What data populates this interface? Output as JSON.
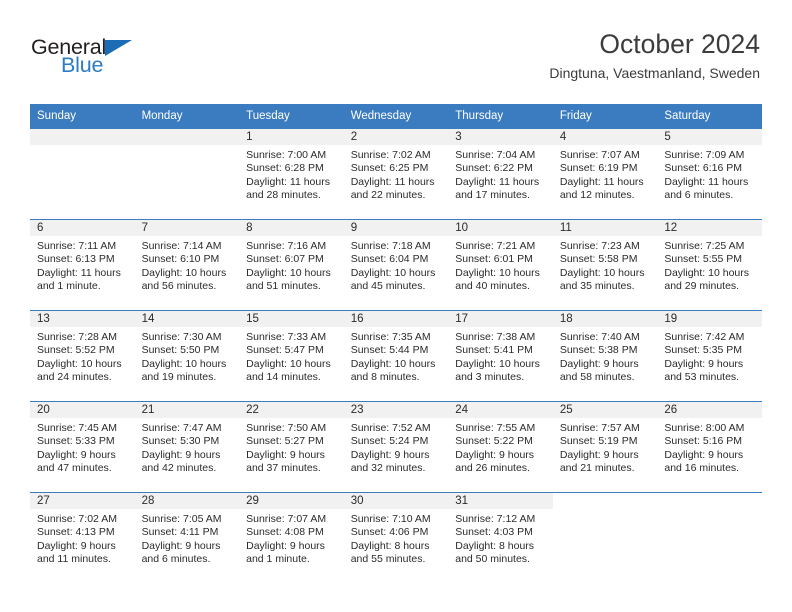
{
  "brand": {
    "name_top": "General",
    "name_bottom": "Blue",
    "triangle_color": "#1b6cb5",
    "text_color": "#231f20",
    "blue_color": "#2b7cc4"
  },
  "header": {
    "title": "October 2024",
    "subtitle": "Dingtuna, Vaestmanland, Sweden"
  },
  "theme": {
    "header_blue": "#3b7cc0",
    "day_band_gray": "#f1f1f1",
    "text": "#2b2b2b"
  },
  "weekday_headers": [
    "Sunday",
    "Monday",
    "Tuesday",
    "Wednesday",
    "Thursday",
    "Friday",
    "Saturday"
  ],
  "labels": {
    "sunrise": "Sunrise:",
    "sunset": "Sunset:",
    "daylight": "Daylight:"
  },
  "weeks": [
    [
      {
        "day": "",
        "blank": true,
        "sunrise": "",
        "sunset": "",
        "daylight_line1": "",
        "daylight_line2": ""
      },
      {
        "day": "",
        "blank": true,
        "sunrise": "",
        "sunset": "",
        "daylight_line1": "",
        "daylight_line2": ""
      },
      {
        "day": "1",
        "sunrise": "Sunrise: 7:00 AM",
        "sunset": "Sunset: 6:28 PM",
        "daylight_line1": "Daylight: 11 hours",
        "daylight_line2": "and 28 minutes."
      },
      {
        "day": "2",
        "sunrise": "Sunrise: 7:02 AM",
        "sunset": "Sunset: 6:25 PM",
        "daylight_line1": "Daylight: 11 hours",
        "daylight_line2": "and 22 minutes."
      },
      {
        "day": "3",
        "sunrise": "Sunrise: 7:04 AM",
        "sunset": "Sunset: 6:22 PM",
        "daylight_line1": "Daylight: 11 hours",
        "daylight_line2": "and 17 minutes."
      },
      {
        "day": "4",
        "sunrise": "Sunrise: 7:07 AM",
        "sunset": "Sunset: 6:19 PM",
        "daylight_line1": "Daylight: 11 hours",
        "daylight_line2": "and 12 minutes."
      },
      {
        "day": "5",
        "sunrise": "Sunrise: 7:09 AM",
        "sunset": "Sunset: 6:16 PM",
        "daylight_line1": "Daylight: 11 hours",
        "daylight_line2": "and 6 minutes."
      }
    ],
    [
      {
        "day": "6",
        "sunrise": "Sunrise: 7:11 AM",
        "sunset": "Sunset: 6:13 PM",
        "daylight_line1": "Daylight: 11 hours",
        "daylight_line2": "and 1 minute."
      },
      {
        "day": "7",
        "sunrise": "Sunrise: 7:14 AM",
        "sunset": "Sunset: 6:10 PM",
        "daylight_line1": "Daylight: 10 hours",
        "daylight_line2": "and 56 minutes."
      },
      {
        "day": "8",
        "sunrise": "Sunrise: 7:16 AM",
        "sunset": "Sunset: 6:07 PM",
        "daylight_line1": "Daylight: 10 hours",
        "daylight_line2": "and 51 minutes."
      },
      {
        "day": "9",
        "sunrise": "Sunrise: 7:18 AM",
        "sunset": "Sunset: 6:04 PM",
        "daylight_line1": "Daylight: 10 hours",
        "daylight_line2": "and 45 minutes."
      },
      {
        "day": "10",
        "sunrise": "Sunrise: 7:21 AM",
        "sunset": "Sunset: 6:01 PM",
        "daylight_line1": "Daylight: 10 hours",
        "daylight_line2": "and 40 minutes."
      },
      {
        "day": "11",
        "sunrise": "Sunrise: 7:23 AM",
        "sunset": "Sunset: 5:58 PM",
        "daylight_line1": "Daylight: 10 hours",
        "daylight_line2": "and 35 minutes."
      },
      {
        "day": "12",
        "sunrise": "Sunrise: 7:25 AM",
        "sunset": "Sunset: 5:55 PM",
        "daylight_line1": "Daylight: 10 hours",
        "daylight_line2": "and 29 minutes."
      }
    ],
    [
      {
        "day": "13",
        "sunrise": "Sunrise: 7:28 AM",
        "sunset": "Sunset: 5:52 PM",
        "daylight_line1": "Daylight: 10 hours",
        "daylight_line2": "and 24 minutes."
      },
      {
        "day": "14",
        "sunrise": "Sunrise: 7:30 AM",
        "sunset": "Sunset: 5:50 PM",
        "daylight_line1": "Daylight: 10 hours",
        "daylight_line2": "and 19 minutes."
      },
      {
        "day": "15",
        "sunrise": "Sunrise: 7:33 AM",
        "sunset": "Sunset: 5:47 PM",
        "daylight_line1": "Daylight: 10 hours",
        "daylight_line2": "and 14 minutes."
      },
      {
        "day": "16",
        "sunrise": "Sunrise: 7:35 AM",
        "sunset": "Sunset: 5:44 PM",
        "daylight_line1": "Daylight: 10 hours",
        "daylight_line2": "and 8 minutes."
      },
      {
        "day": "17",
        "sunrise": "Sunrise: 7:38 AM",
        "sunset": "Sunset: 5:41 PM",
        "daylight_line1": "Daylight: 10 hours",
        "daylight_line2": "and 3 minutes."
      },
      {
        "day": "18",
        "sunrise": "Sunrise: 7:40 AM",
        "sunset": "Sunset: 5:38 PM",
        "daylight_line1": "Daylight: 9 hours",
        "daylight_line2": "and 58 minutes."
      },
      {
        "day": "19",
        "sunrise": "Sunrise: 7:42 AM",
        "sunset": "Sunset: 5:35 PM",
        "daylight_line1": "Daylight: 9 hours",
        "daylight_line2": "and 53 minutes."
      }
    ],
    [
      {
        "day": "20",
        "sunrise": "Sunrise: 7:45 AM",
        "sunset": "Sunset: 5:33 PM",
        "daylight_line1": "Daylight: 9 hours",
        "daylight_line2": "and 47 minutes."
      },
      {
        "day": "21",
        "sunrise": "Sunrise: 7:47 AM",
        "sunset": "Sunset: 5:30 PM",
        "daylight_line1": "Daylight: 9 hours",
        "daylight_line2": "and 42 minutes."
      },
      {
        "day": "22",
        "sunrise": "Sunrise: 7:50 AM",
        "sunset": "Sunset: 5:27 PM",
        "daylight_line1": "Daylight: 9 hours",
        "daylight_line2": "and 37 minutes."
      },
      {
        "day": "23",
        "sunrise": "Sunrise: 7:52 AM",
        "sunset": "Sunset: 5:24 PM",
        "daylight_line1": "Daylight: 9 hours",
        "daylight_line2": "and 32 minutes."
      },
      {
        "day": "24",
        "sunrise": "Sunrise: 7:55 AM",
        "sunset": "Sunset: 5:22 PM",
        "daylight_line1": "Daylight: 9 hours",
        "daylight_line2": "and 26 minutes."
      },
      {
        "day": "25",
        "sunrise": "Sunrise: 7:57 AM",
        "sunset": "Sunset: 5:19 PM",
        "daylight_line1": "Daylight: 9 hours",
        "daylight_line2": "and 21 minutes."
      },
      {
        "day": "26",
        "sunrise": "Sunrise: 8:00 AM",
        "sunset": "Sunset: 5:16 PM",
        "daylight_line1": "Daylight: 9 hours",
        "daylight_line2": "and 16 minutes."
      }
    ],
    [
      {
        "day": "27",
        "sunrise": "Sunrise: 7:02 AM",
        "sunset": "Sunset: 4:13 PM",
        "daylight_line1": "Daylight: 9 hours",
        "daylight_line2": "and 11 minutes."
      },
      {
        "day": "28",
        "sunrise": "Sunrise: 7:05 AM",
        "sunset": "Sunset: 4:11 PM",
        "daylight_line1": "Daylight: 9 hours",
        "daylight_line2": "and 6 minutes."
      },
      {
        "day": "29",
        "sunrise": "Sunrise: 7:07 AM",
        "sunset": "Sunset: 4:08 PM",
        "daylight_line1": "Daylight: 9 hours",
        "daylight_line2": "and 1 minute."
      },
      {
        "day": "30",
        "sunrise": "Sunrise: 7:10 AM",
        "sunset": "Sunset: 4:06 PM",
        "daylight_line1": "Daylight: 8 hours",
        "daylight_line2": "and 55 minutes."
      },
      {
        "day": "31",
        "sunrise": "Sunrise: 7:12 AM",
        "sunset": "Sunset: 4:03 PM",
        "daylight_line1": "Daylight: 8 hours",
        "daylight_line2": "and 50 minutes."
      },
      {
        "day": "",
        "blank": true,
        "sunrise": "",
        "sunset": "",
        "daylight_line1": "",
        "daylight_line2": ""
      },
      {
        "day": "",
        "blank": true,
        "sunrise": "",
        "sunset": "",
        "daylight_line1": "",
        "daylight_line2": ""
      }
    ]
  ]
}
